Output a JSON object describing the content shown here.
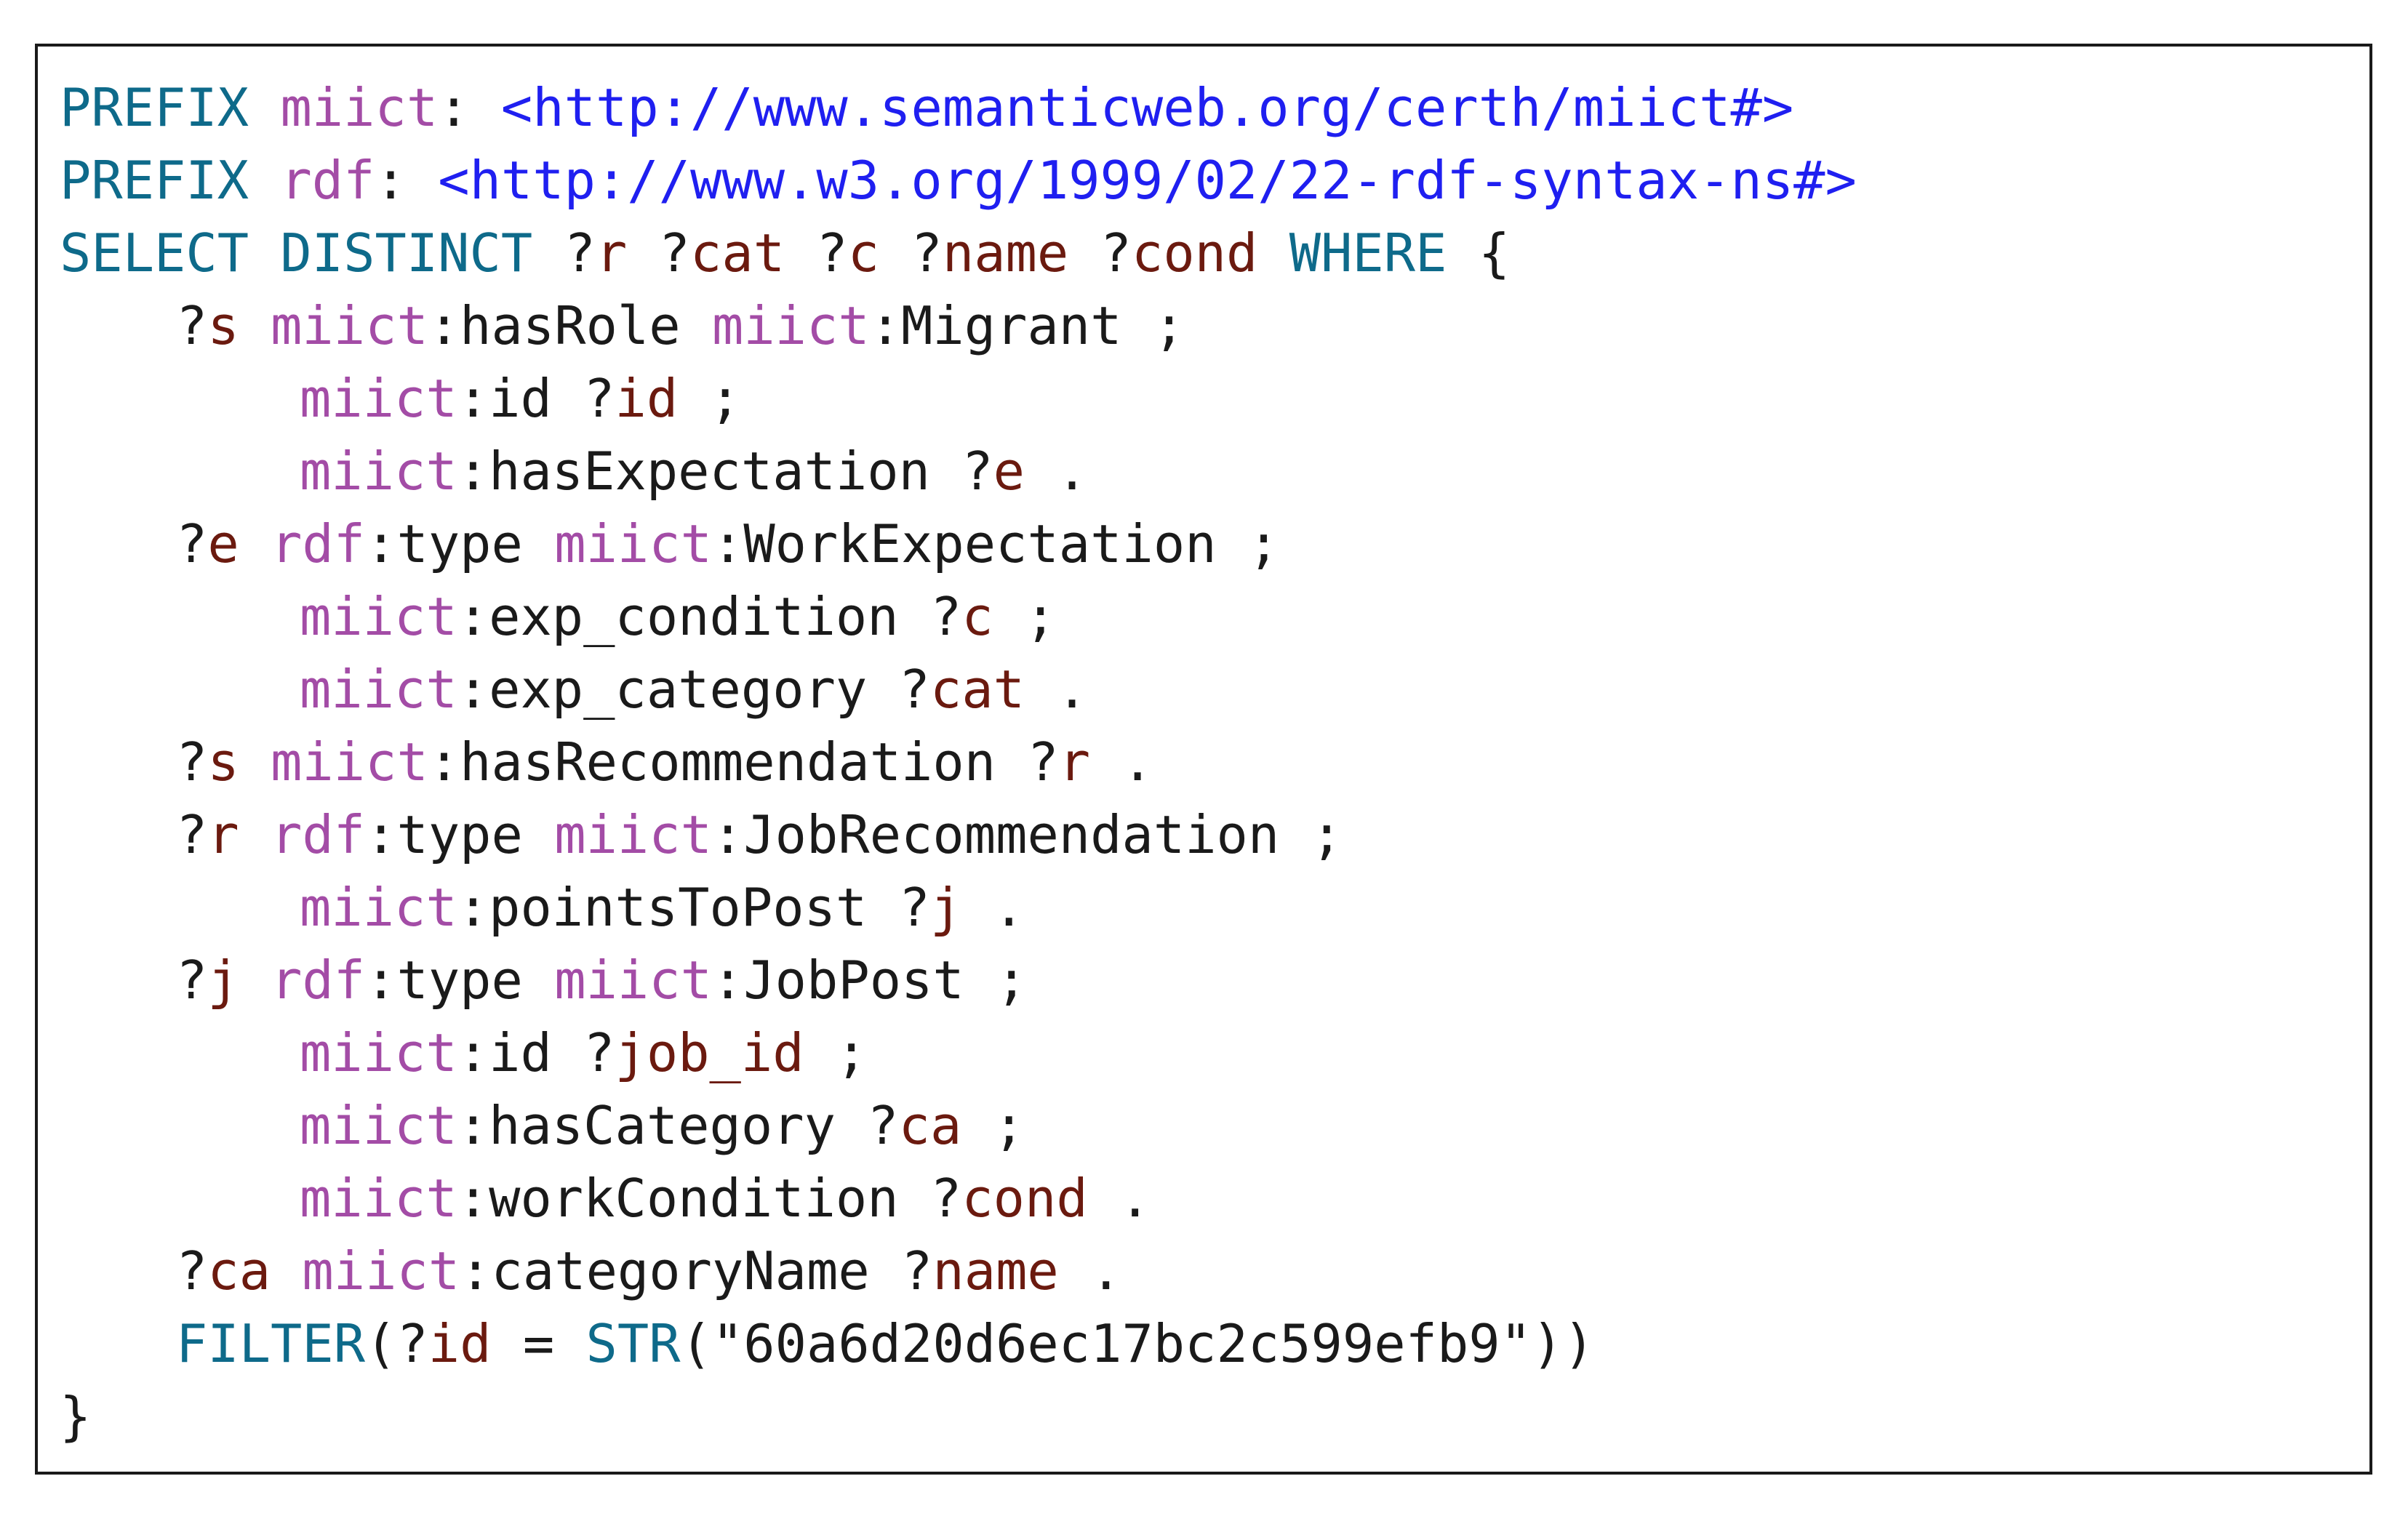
{
  "colors": {
    "keyword": "#0e6a8a",
    "prefix": "#a34ca6",
    "iri": "#1f1ff0",
    "variable": "#6b1a0f",
    "text": "#1a1a1a",
    "border": "#1a1a1a",
    "background": "#ffffff"
  },
  "query": {
    "l1": {
      "kw": "PREFIX",
      "pfx": "miict",
      "sep": ":",
      "iri": "<http://www.semanticweb.org/certh/miict#>"
    },
    "l2": {
      "kw": "PREFIX",
      "pfx": "rdf",
      "sep": ":",
      "iri": "<http://www.w3.org/1999/02/22-rdf-syntax-ns#>"
    },
    "l3": {
      "kw1": "SELECT DISTINCT",
      "q1": "?",
      "v1": "r",
      "q2": "?",
      "v2": "cat",
      "q3": "?",
      "v3": "c",
      "q4": "?",
      "v4": "name",
      "q5": "?",
      "v5": "cond",
      "kw2": "WHERE",
      "brace": "{"
    },
    "l4": {
      "q": "?",
      "v": "s",
      "p1": "miict",
      "t1": ":hasRole",
      "p2": "miict",
      "t2": ":Migrant ;"
    },
    "l5": {
      "p1": "miict",
      "t1": ":id ?",
      "v": "id",
      "t2": " ;"
    },
    "l6": {
      "p1": "miict",
      "t1": ":hasExpectation ?",
      "v": "e",
      "t2": " ."
    },
    "l7": {
      "q": "?",
      "v": "e",
      "p1": "rdf",
      "t1": ":type",
      "p2": "miict",
      "t2": ":WorkExpectation ;"
    },
    "l8": {
      "p1": "miict",
      "t1": ":exp_condition ?",
      "v": "c",
      "t2": " ;"
    },
    "l9": {
      "p1": "miict",
      "t1": ":exp_category ?",
      "v": "cat",
      "t2": " ."
    },
    "l10": {
      "q": "?",
      "v1": "s",
      "p1": "miict",
      "t1": ":hasRecommendation ?",
      "v2": "r",
      "t2": " ."
    },
    "l11": {
      "q": "?",
      "v": "r",
      "p1": "rdf",
      "t1": ":type",
      "p2": "miict",
      "t2": ":JobRecommendation ;"
    },
    "l12": {
      "p1": "miict",
      "t1": ":pointsToPost ?",
      "v": "j",
      "t2": " ."
    },
    "l13": {
      "q": "?",
      "v": "j",
      "p1": "rdf",
      "t1": ":type",
      "p2": "miict",
      "t2": ":JobPost ;"
    },
    "l14": {
      "p1": "miict",
      "t1": ":id ?",
      "v": "job_id",
      "t2": " ;"
    },
    "l15": {
      "p1": "miict",
      "t1": ":hasCategory ?",
      "v": "ca",
      "t2": " ;"
    },
    "l16": {
      "p1": "miict",
      "t1": ":workCondition ?",
      "v": "cond",
      "t2": " ."
    },
    "l17": {
      "q": "?",
      "v1": "ca",
      "p1": "miict",
      "t1": ":categoryName ?",
      "v2": "name",
      "t2": " ."
    },
    "l18": {
      "kw1": "FILTER",
      "t1": "(?",
      "v": "id",
      "t2": " = ",
      "kw2": "STR",
      "t3": "(\"60a6d20d6ec17bc2c599efb9\"))"
    },
    "l19": {
      "brace": "}"
    }
  }
}
